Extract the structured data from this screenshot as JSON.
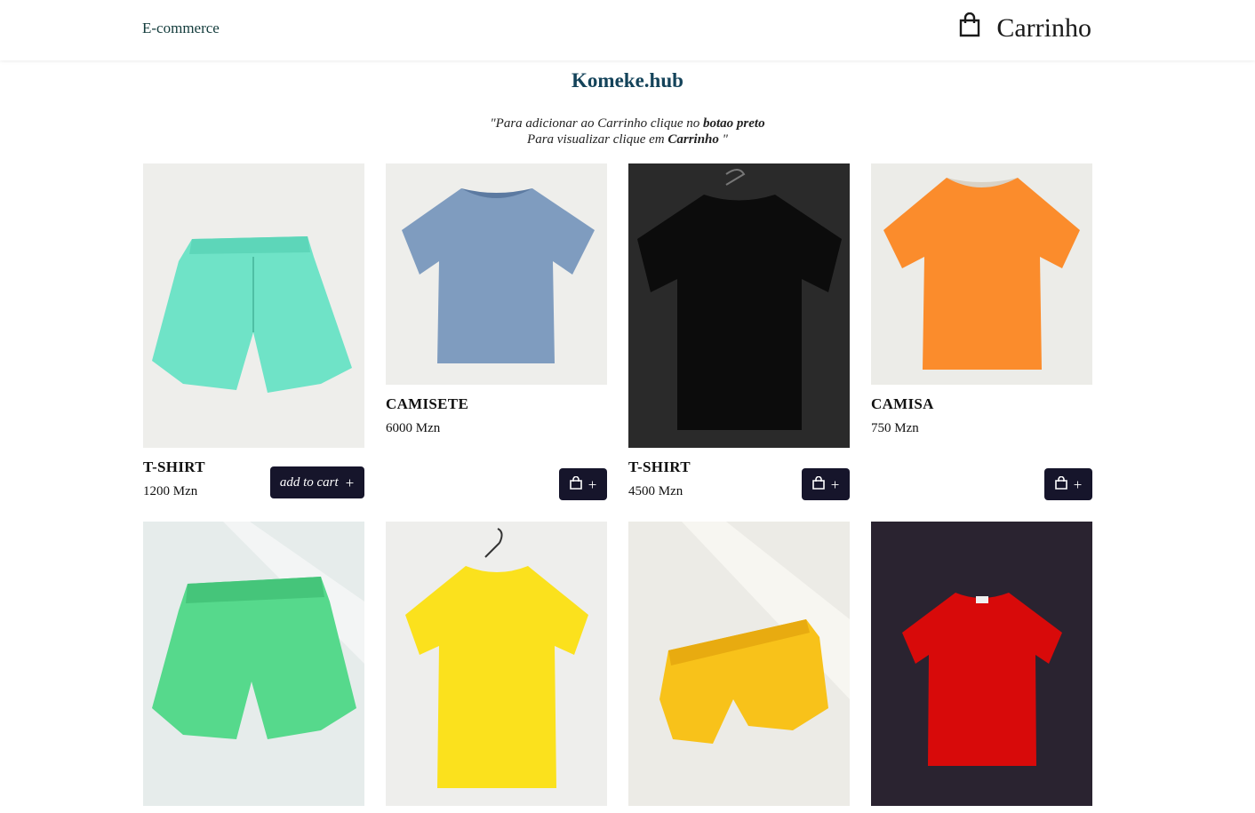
{
  "header": {
    "brand": "E-commerce",
    "cart_label": "Carrinho",
    "cart_icon": "shopping-bag-icon"
  },
  "title": "Komeke.hub",
  "instructions": {
    "open_quote": "\"Para adicionar ao Carrinho clique no ",
    "bold1": "botao preto",
    "line2_prefix": "Para visualizar clique em ",
    "bold2": "Carrinho",
    "close_quote": " \""
  },
  "products": [
    {
      "name": "T-SHIRT",
      "price": "1200 Mzn",
      "button": "add to cart",
      "image": "mint-shorts"
    },
    {
      "name": "CAMISETE",
      "price": "6000 Mzn",
      "image": "blue-tshirt"
    },
    {
      "name": "T-SHIRT",
      "price": "4500 Mzn",
      "image": "black-tshirt"
    },
    {
      "name": "CAMISA",
      "price": "750 Mzn",
      "image": "orange-tshirt"
    },
    {
      "image": "green-shorts"
    },
    {
      "image": "yellow-tshirt"
    },
    {
      "image": "yellow-shorts"
    },
    {
      "image": "red-tshirt"
    }
  ],
  "button_plus": "+",
  "colors": {
    "button_bg": "#16152b",
    "title": "#14435a",
    "brand": "#123b3b"
  }
}
